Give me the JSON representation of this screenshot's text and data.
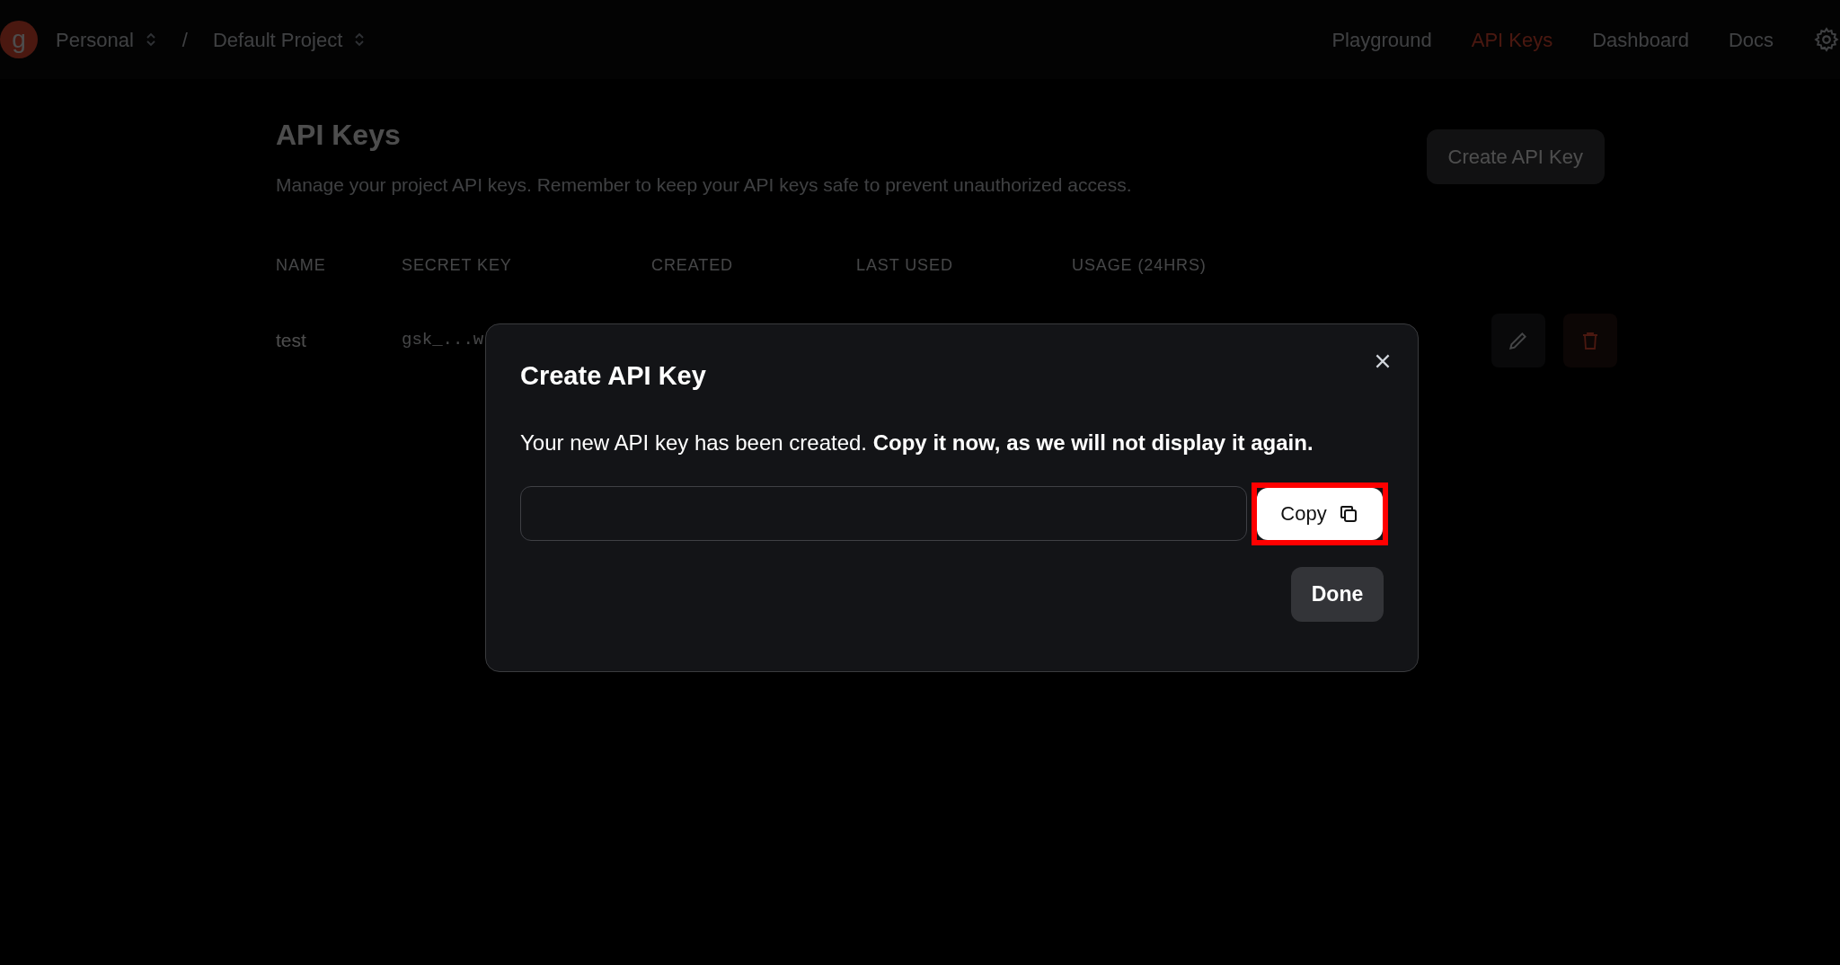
{
  "header": {
    "logo": "g",
    "breadcrumbs": [
      {
        "label": "Personal"
      },
      {
        "label": "Default Project"
      }
    ],
    "separator": "/",
    "nav": [
      {
        "label": "Playground",
        "selected": false
      },
      {
        "label": "API Keys",
        "selected": true
      },
      {
        "label": "Dashboard",
        "selected": false
      },
      {
        "label": "Docs",
        "selected": false
      }
    ]
  },
  "page": {
    "title": "API Keys",
    "description": "Manage your project API keys. Remember to keep your API keys safe to prevent unauthorized access.",
    "create_button": "Create API Key",
    "table": {
      "columns": [
        "NAME",
        "SECRET KEY",
        "CREATED",
        "LAST USED",
        "USAGE (24HRS)"
      ],
      "rows": [
        {
          "name": "test",
          "secret_key": "gsk_...w"
        }
      ]
    }
  },
  "dialog": {
    "title": "Create API Key",
    "message": "Your new API key has been created. **Copy it now, as we will not display it again.**",
    "copy_button": "Copy",
    "copy_highlighted": true,
    "done_button": "Done"
  }
}
